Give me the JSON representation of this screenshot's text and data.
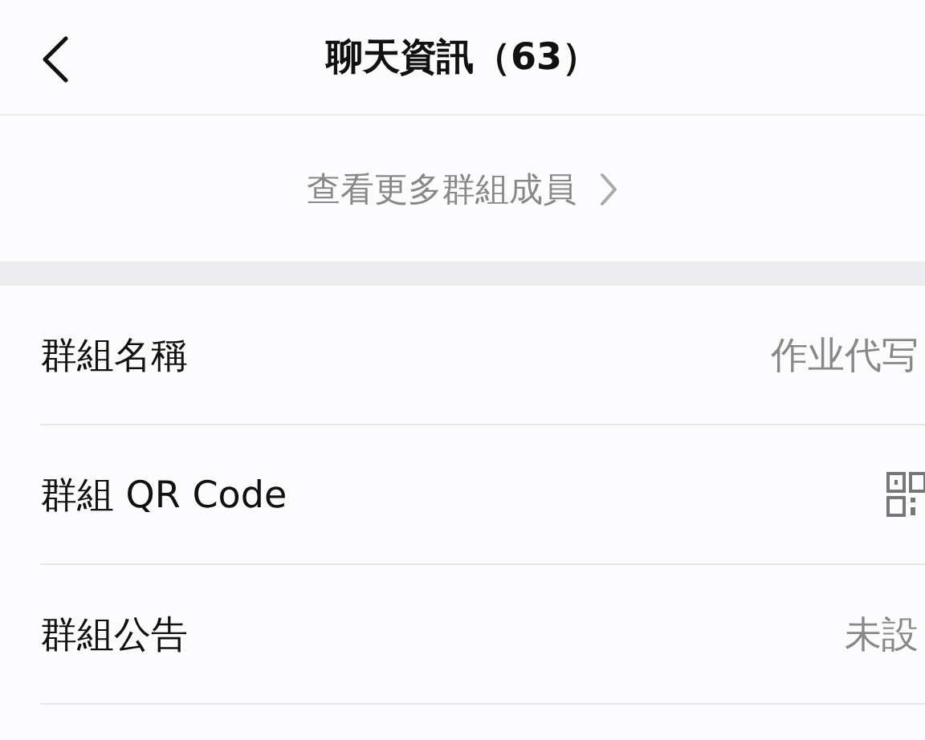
{
  "header": {
    "title": "聊天資訊（63）"
  },
  "more_members": {
    "label": "查看更多群組成員"
  },
  "rows": [
    {
      "kind": "text",
      "label": "群組名稱",
      "value": "作业代写"
    },
    {
      "kind": "qr",
      "label": "群組 QR Code"
    },
    {
      "kind": "text",
      "label": "群組公告",
      "value": "未設"
    }
  ]
}
